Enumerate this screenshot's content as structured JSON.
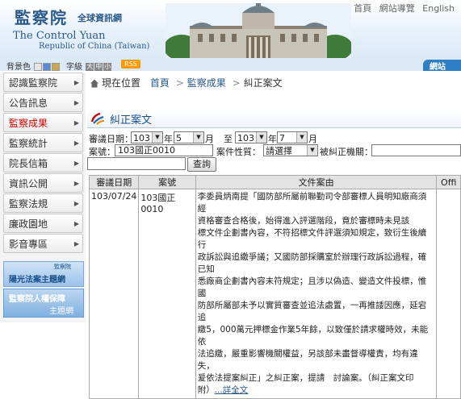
{
  "header": {
    "logo_cn": "監察院",
    "logo_cn_sub": "全球資訊網",
    "logo_en": "The Control Yuan",
    "logo_en_sub": "Republic of China (Taiwan)",
    "top_links": [
      "首頁",
      "網站導覽",
      "English"
    ]
  },
  "settings": {
    "bg_color_label": "背景色",
    "font_size_label": "字級",
    "font_sizes": [
      "大",
      "中",
      "小"
    ],
    "swatch_colors": [
      "#e6e6e6",
      "#5b8bd0",
      "#c9a94d"
    ],
    "rss_label": "RSS",
    "sitemap_tab": "網站"
  },
  "sidebar": {
    "items": [
      {
        "label": "認識監察院",
        "active": false
      },
      {
        "label": "公告訊息",
        "active": false
      },
      {
        "label": "監察成果",
        "active": true
      },
      {
        "label": "監察統計",
        "active": false
      },
      {
        "label": "院長信箱",
        "active": false
      },
      {
        "label": "資訊公開",
        "active": false
      },
      {
        "label": "監察法規",
        "active": false
      },
      {
        "label": "廉政園地",
        "active": false
      },
      {
        "label": "影音專區",
        "active": false
      }
    ],
    "banner1_small": "監察院",
    "banner1_main": "陽光法案主題網",
    "banner2_main": "監察院人權保障",
    "banner2_sub": "主題網"
  },
  "breadcrumb": {
    "prefix": "現在位置",
    "items": [
      "首頁",
      "監察成果",
      "糾正案文"
    ],
    "separator": ">"
  },
  "section_title": "糾正案文",
  "form": {
    "date_label": "審議日期：",
    "from_year": "103",
    "year_unit": "年",
    "from_month": "5",
    "month_unit": "月",
    "to_label": "至",
    "to_year": "103",
    "to_month": "7",
    "case_no_label": "案號：",
    "case_no_value": "103國正0010",
    "nature_label": "案件性質：",
    "nature_value": "請選擇",
    "target_label": "被糾正機關：",
    "target_value": "",
    "keyword_value": "",
    "query_button": "查詢"
  },
  "table": {
    "headers": [
      "審議日期",
      "案號",
      "文件案由",
      "Offi"
    ],
    "rows": [
      {
        "date": "103/07/24",
        "case_no": "103國正0010",
        "reason_lines": [
          "李委員炳南提「國防部所屬前聯勤司令部審標人員明知廠商須經",
          "資格審查合格後，始得進入評選階段，竟於審標時未見該",
          "標文件企劃書內容，不符招標文件評選須知規定，致衍生後續行",
          "政訴訟與追繳爭議；又國防部採購室於辦理行政訴訟過程，確已知",
          "悉廠商企劃書內容未符規定；且涉以偽造、變造文件投標，惟國",
          "防部所屬部未予以實質審查並追法處置，一再推諉因應，延宕追",
          "繳5，000萬元押標金作業5年餘，以致僅於請求權時效，未能依",
          "法追繳，嚴重影響機關權益，另該部未盡督導權責，均有違失，",
          "爰依法提案糾正」之糾正案，提請　討論案。（糾正案文印"
        ],
        "last_line_text": "附）",
        "more_link": "...詳全文"
      }
    ]
  }
}
